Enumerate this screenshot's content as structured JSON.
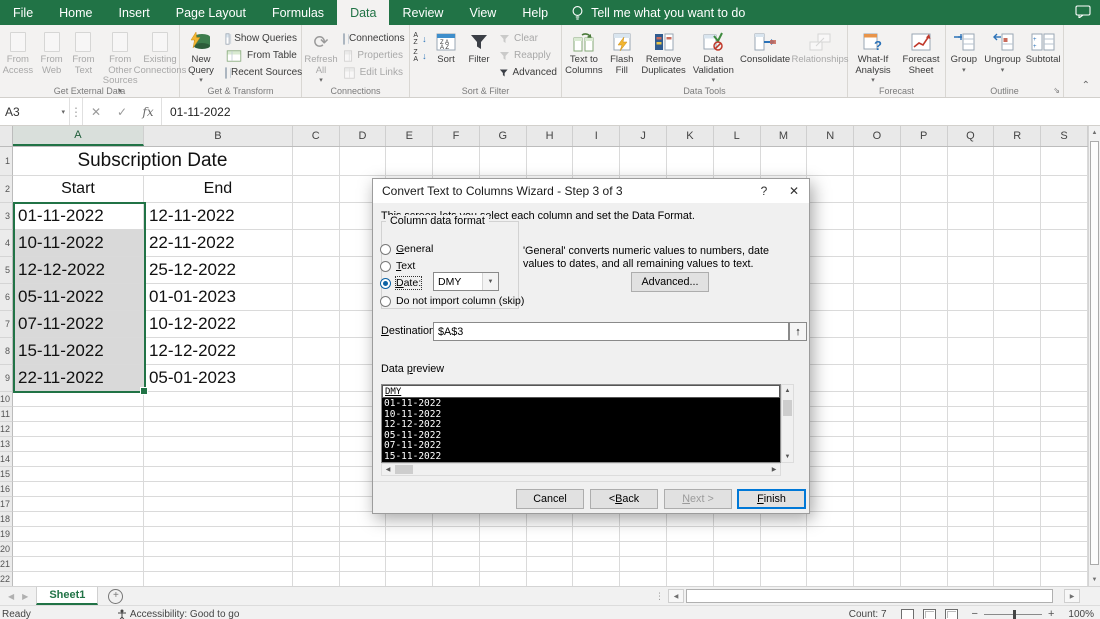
{
  "app": {
    "accent_color": "#217346"
  },
  "menu": {
    "tabs": [
      "File",
      "Home",
      "Insert",
      "Page Layout",
      "Formulas",
      "Data",
      "Review",
      "View",
      "Help"
    ],
    "active_tab": "Data",
    "tell_me": "Tell me what you want to do"
  },
  "ribbon": {
    "groups": [
      {
        "label": "Get External Data",
        "items": [
          {
            "label": "From Access"
          },
          {
            "label": "From Web"
          },
          {
            "label": "From Text"
          },
          {
            "label": "From Other Sources"
          },
          {
            "label": "Existing Connections"
          }
        ]
      },
      {
        "label": "Get & Transform",
        "items": [
          {
            "label": "New Query"
          },
          {
            "label": "Show Queries"
          },
          {
            "label": "From Table"
          },
          {
            "label": "Recent Sources"
          }
        ]
      },
      {
        "label": "Connections",
        "items": [
          {
            "label": "Refresh All"
          },
          {
            "label": "Connections"
          },
          {
            "label": "Properties"
          },
          {
            "label": "Edit Links"
          }
        ]
      },
      {
        "label": "Sort & Filter",
        "items": [
          {
            "label": "Sort"
          },
          {
            "label": "Filter"
          },
          {
            "label": "Clear"
          },
          {
            "label": "Reapply"
          },
          {
            "label": "Advanced"
          }
        ]
      },
      {
        "label": "Data Tools",
        "items": [
          {
            "label": "Text to Columns"
          },
          {
            "label": "Flash Fill"
          },
          {
            "label": "Remove Duplicates"
          },
          {
            "label": "Data Validation"
          },
          {
            "label": "Consolidate"
          },
          {
            "label": "Relationships"
          }
        ]
      },
      {
        "label": "Forecast",
        "items": [
          {
            "label": "What-If Analysis"
          },
          {
            "label": "Forecast Sheet"
          }
        ]
      },
      {
        "label": "Outline",
        "items": [
          {
            "label": "Group"
          },
          {
            "label": "Ungroup"
          },
          {
            "label": "Subtotal"
          }
        ]
      }
    ]
  },
  "formula_bar": {
    "name_box": "A3",
    "value": "01-11-2022"
  },
  "sheet": {
    "columns": [
      "A",
      "B",
      "C",
      "D",
      "E",
      "F",
      "G",
      "H",
      "I",
      "J",
      "K",
      "L",
      "M",
      "N",
      "O",
      "P",
      "Q",
      "R",
      "S"
    ],
    "title": "Subscription Date",
    "column_headers": [
      "Start",
      "End"
    ],
    "rows": [
      [
        "01-11-2022",
        "12-11-2022"
      ],
      [
        "10-11-2022",
        "22-11-2022"
      ],
      [
        "12-12-2022",
        "25-12-2022"
      ],
      [
        "05-11-2022",
        "01-01-2023"
      ],
      [
        "07-11-2022",
        "10-12-2022"
      ],
      [
        "15-11-2022",
        "12-12-2022"
      ],
      [
        "22-11-2022",
        "05-01-2023"
      ]
    ],
    "active_cell": "A3",
    "selection": "A3:A9",
    "total_rows": 22
  },
  "dialog": {
    "title": "Convert Text to Columns Wizard - Step 3 of 3",
    "help_glyph": "?",
    "close_glyph": "✕",
    "description": "This screen lets you select each column and set the Data Format.",
    "format_group_label": "Column data format",
    "radio_general": "General",
    "radio_text": "Text",
    "radio_date": "Date:",
    "radio_skip": "Do not import column (skip)",
    "selected_radio": "Date",
    "date_format_value": "DMY",
    "general_note": "'General' converts numeric values to numbers, date values to dates, and all remaining values to text.",
    "advanced_button": "Advanced...",
    "destination_label": "Destination:",
    "destination_value": "$A$3",
    "preview_label": "Data preview",
    "preview_header": "DMY",
    "preview_rows": [
      "01-11-2022",
      "10-11-2022",
      "12-12-2022",
      "05-11-2022",
      "07-11-2022",
      "15-11-2022"
    ],
    "cancel_button": "Cancel",
    "back_button": "< Back",
    "next_button": "Next >",
    "finish_button": "Finish"
  },
  "sheet_tabs": {
    "active": "Sheet1"
  },
  "status_bar": {
    "mode": "Ready",
    "accessibility": "Accessibility: Good to go",
    "count": "Count: 7",
    "zoom": "100%"
  }
}
